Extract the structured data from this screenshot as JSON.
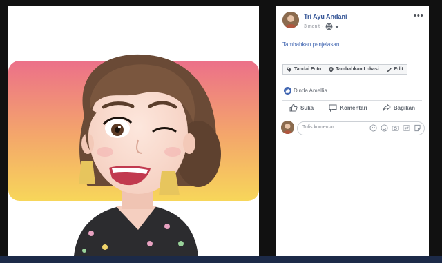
{
  "post": {
    "author": "Tri Ayu Andani",
    "time": "3 menit",
    "privacy_icon": "globe-icon",
    "more_label": "•••",
    "add_description": "Tambahkan penjelasan"
  },
  "tag_buttons": {
    "tag_photo": "Tandai Foto",
    "add_location": "Tambahkan Lokasi",
    "edit": "Edit"
  },
  "reactions": {
    "liked_by": "Dinda Amellia"
  },
  "actions": {
    "like": "Suka",
    "comment": "Komentari",
    "share": "Bagikan"
  },
  "comment": {
    "placeholder": "Tulis komentar..."
  },
  "colors": {
    "link": "#385898",
    "accent": "#4267b2",
    "gradient_top": "#ec7089",
    "gradient_bottom": "#f7d65a"
  }
}
